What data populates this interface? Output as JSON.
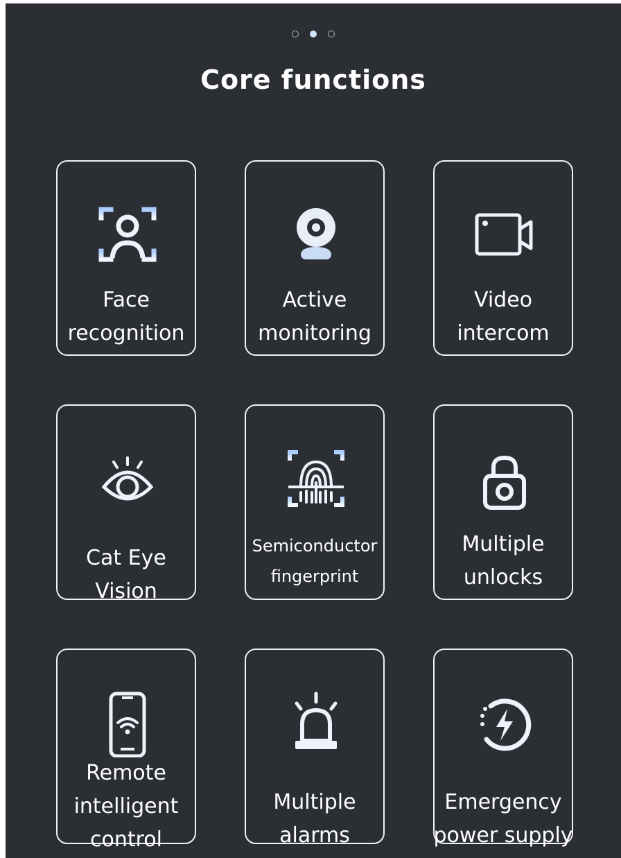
{
  "pager": {
    "pages": 3,
    "active_index": 1
  },
  "header": {
    "title": "Core functions"
  },
  "colors": {
    "background": "#2b2e33",
    "card_border": "#f2f2f2",
    "icon_light": "#f4f7fc",
    "icon_blue": "#9ec4ff",
    "text": "#ffffff"
  },
  "features": [
    {
      "label": "Face\nrecognition",
      "icon": "face-scan-icon"
    },
    {
      "label": "Active\nmonitoring",
      "icon": "webcam-icon"
    },
    {
      "label": "Video\nintercom",
      "icon": "video-camera-icon"
    },
    {
      "label": "Cat Eye\nVision",
      "icon": "eye-icon"
    },
    {
      "label": "Semiconductor\nfingerprint",
      "icon": "fingerprint-scan-icon"
    },
    {
      "label": "Multiple\nunlocks",
      "icon": "padlock-icon"
    },
    {
      "label": "Remote\nintelligent\ncontrol",
      "icon": "smartphone-wifi-icon"
    },
    {
      "label": "Multiple\nalarms",
      "icon": "alarm-siren-icon"
    },
    {
      "label": "Emergency\npower supply",
      "icon": "power-bolt-icon"
    }
  ]
}
